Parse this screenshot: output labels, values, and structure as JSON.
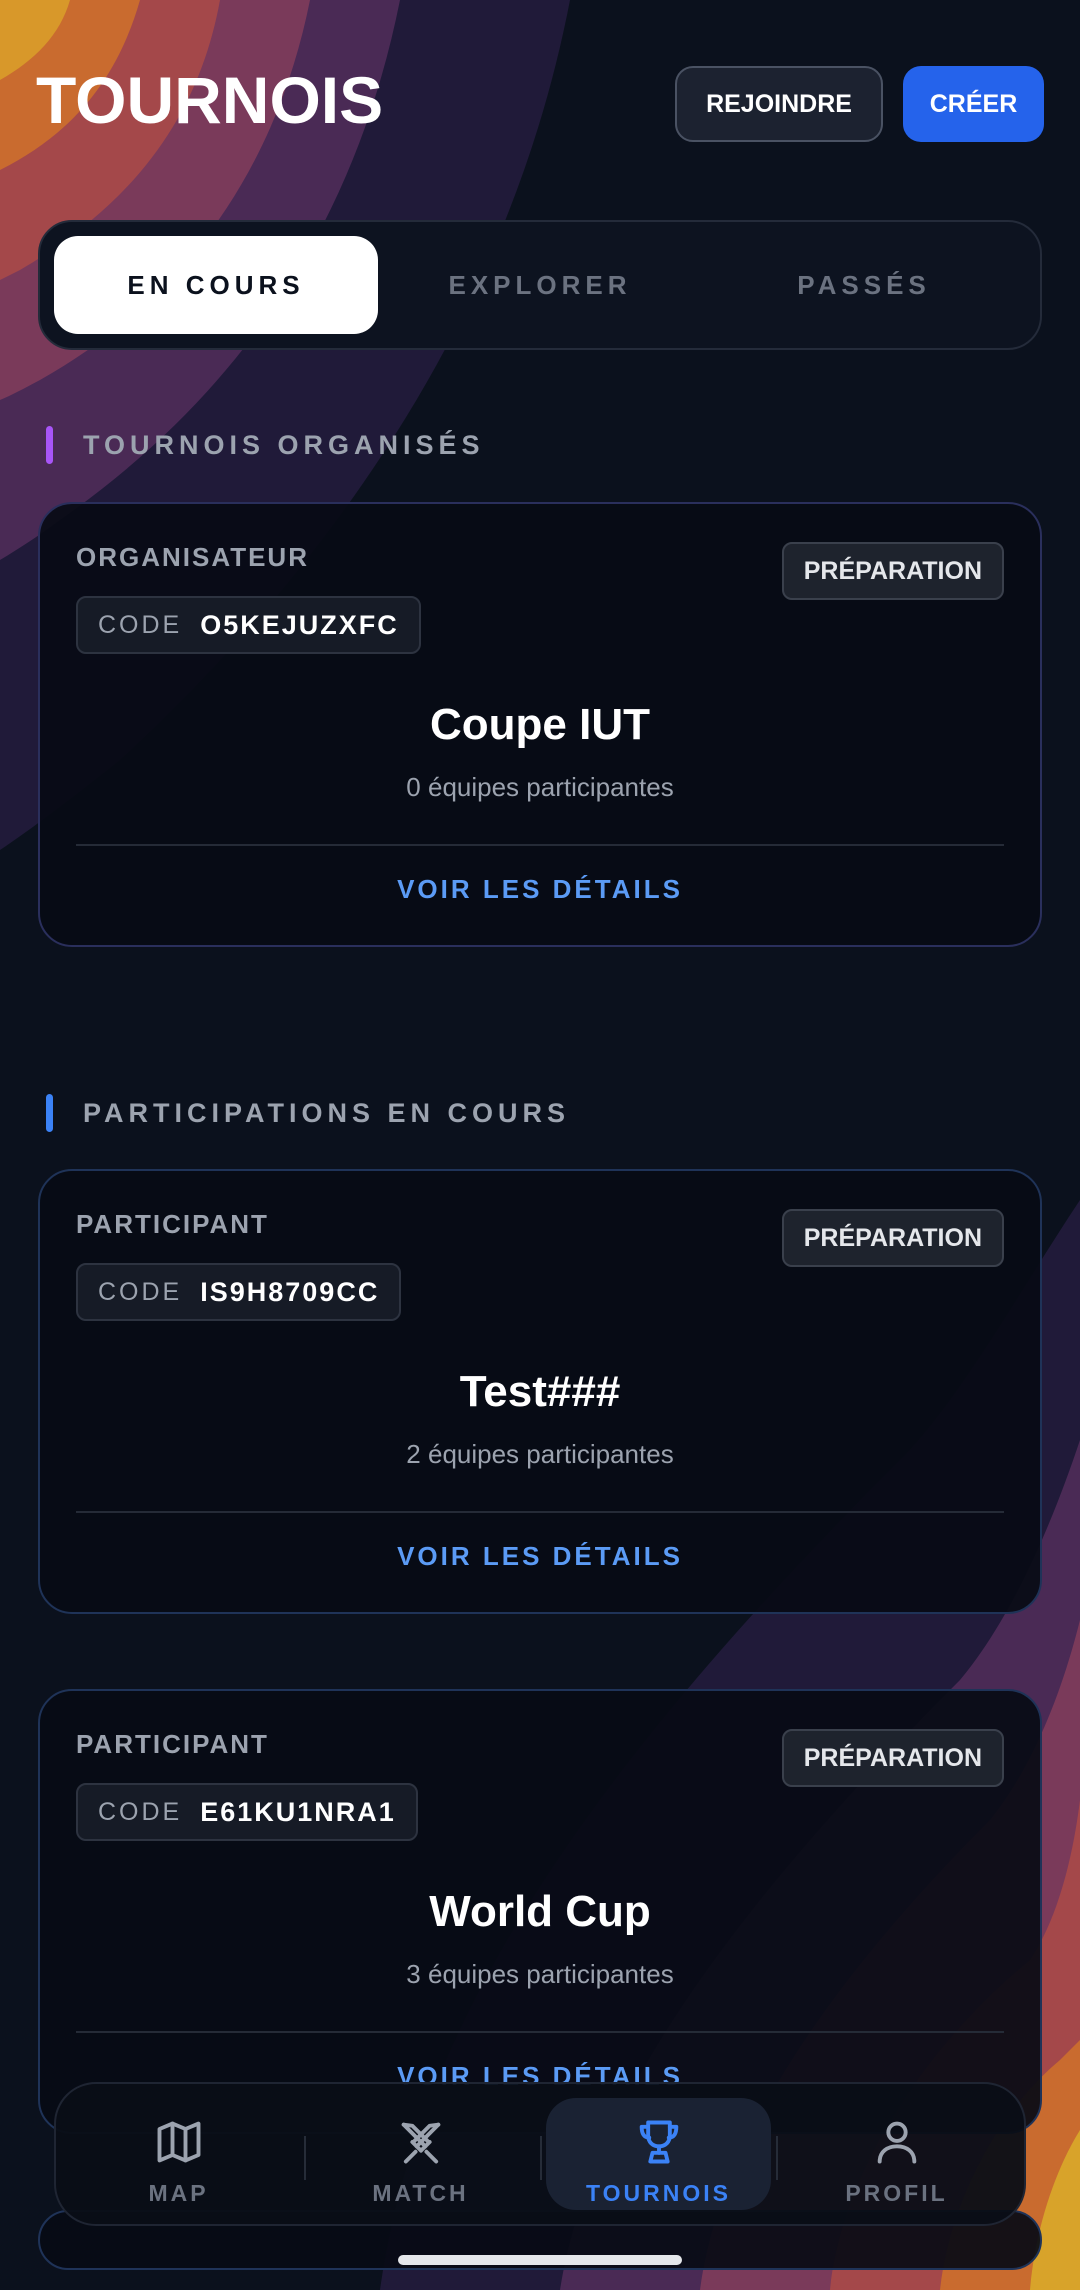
{
  "header": {
    "title": "TOURNOIS",
    "join_label": "REJOINDRE",
    "create_label": "CRÉER"
  },
  "tabs": [
    {
      "label": "EN COURS",
      "active": true
    },
    {
      "label": "EXPLORER",
      "active": false
    },
    {
      "label": "PASSÉS",
      "active": false
    }
  ],
  "sections": {
    "organized": {
      "label": "TOURNOIS ORGANISÉS",
      "accent": "#a855f7"
    },
    "participations": {
      "label": "PARTICIPATIONS EN COURS",
      "accent": "#3b82f6"
    }
  },
  "cards": [
    {
      "role": "ORGANISATEUR",
      "code_key": "CODE",
      "code": "O5KEJUZXFC",
      "status": "PRÉPARATION",
      "name": "Coupe IUT",
      "teams": "0 équipes participantes",
      "details": "VOIR LES DÉTAILS"
    },
    {
      "role": "PARTICIPANT",
      "code_key": "CODE",
      "code": "IS9H8709CC",
      "status": "PRÉPARATION",
      "name": "Test###",
      "teams": "2 équipes participantes",
      "details": "VOIR LES DÉTAILS"
    },
    {
      "role": "PARTICIPANT",
      "code_key": "CODE",
      "code": "E61KU1NRA1",
      "status": "PRÉPARATION",
      "name": "World Cup",
      "teams": "3 équipes participantes",
      "details": "VOIR LES DÉTAILS"
    }
  ],
  "nav": [
    {
      "label": "MAP",
      "icon": "map-icon",
      "active": false
    },
    {
      "label": "MATCH",
      "icon": "crossed-swords-icon",
      "active": false
    },
    {
      "label": "TOURNOIS",
      "icon": "trophy-icon",
      "active": true
    },
    {
      "label": "PROFIL",
      "icon": "user-icon",
      "active": false
    }
  ],
  "colors": {
    "background": "#0b111d",
    "primary": "#2563eb",
    "link": "#5b9bf5",
    "active_nav": "#3b82f6"
  }
}
